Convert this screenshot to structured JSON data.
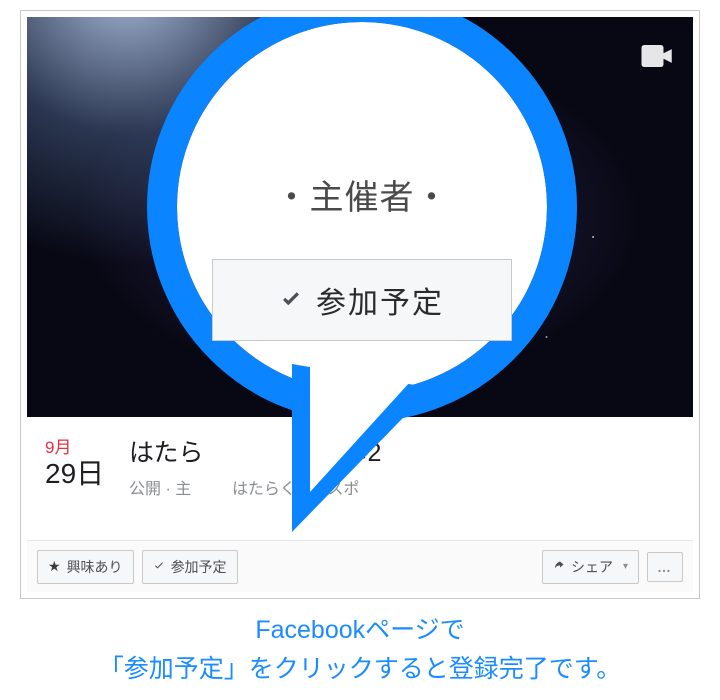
{
  "event": {
    "month": "9月",
    "day": "29日",
    "title_left": "はたら",
    "title_right": "スポ2",
    "sub_left": "公開 · 主",
    "sub_right": "はたらくエキスポ"
  },
  "magnifier": {
    "header": "・主催者・",
    "button_label": "参加予定"
  },
  "actions": {
    "interested": "興味あり",
    "going": "参加予定",
    "share": "シェア",
    "more": "…"
  },
  "caption": {
    "line1": "Facebookページで",
    "line2": "「参加予定」をクリックすると登録完了です。"
  },
  "icons": {
    "camera": "camera-icon",
    "star": "star-icon",
    "check": "check-icon",
    "share": "share-icon"
  }
}
